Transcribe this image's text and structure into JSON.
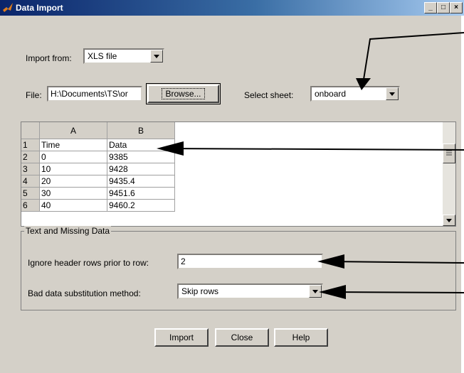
{
  "window": {
    "title": "Data Import",
    "icon": "matlab-logo-icon",
    "controls": {
      "minimize": "_",
      "maximize": "□",
      "close": "×"
    }
  },
  "import_from": {
    "label": "Import from:",
    "value": "XLS file"
  },
  "file": {
    "label": "File:",
    "value": "H:\\Documents\\TS\\or",
    "browse_label": "Browse..."
  },
  "sheet": {
    "label": "Select sheet:",
    "value": "onboard"
  },
  "table": {
    "columns": [
      "A",
      "B"
    ],
    "rows": [
      {
        "num": "1",
        "a": "Time",
        "b": "Data"
      },
      {
        "num": "2",
        "a": "0",
        "b": "9385"
      },
      {
        "num": "3",
        "a": "10",
        "b": "9428"
      },
      {
        "num": "4",
        "a": "20",
        "b": "9435.4"
      },
      {
        "num": "5",
        "a": "30",
        "b": "9451.6"
      },
      {
        "num": "6",
        "a": "40",
        "b": "9460.2"
      }
    ]
  },
  "text_missing": {
    "group_label": "Text and Missing Data",
    "ignore_label": "Ignore header rows prior to row:",
    "ignore_value": "2",
    "bad_label": "Bad data substitution method:",
    "bad_value": "Skip rows"
  },
  "buttons": {
    "import": "Import",
    "close": "Close",
    "help": "Help"
  },
  "colors": {
    "title_bar": "#0a246a",
    "window_bg": "#d4d0c8"
  }
}
